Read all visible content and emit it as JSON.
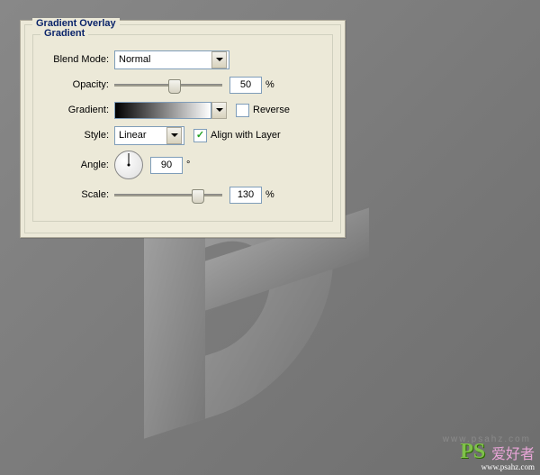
{
  "dialog": {
    "title": "Gradient Overlay",
    "group": "Gradient",
    "blend_mode": {
      "label": "Blend Mode:",
      "value": "Normal"
    },
    "opacity": {
      "label": "Opacity:",
      "value": "50",
      "unit": "%",
      "thumb_pct": 50
    },
    "gradient": {
      "label": "Gradient:"
    },
    "reverse": {
      "label": "Reverse",
      "checked": false
    },
    "style": {
      "label": "Style:",
      "value": "Linear"
    },
    "align": {
      "label": "Align with Layer",
      "checked": true
    },
    "angle": {
      "label": "Angle:",
      "value": "90",
      "unit": "°"
    },
    "scale": {
      "label": "Scale:",
      "value": "130",
      "unit": "%",
      "thumb_pct": 72
    }
  },
  "watermark": {
    "ps": "PS",
    "text": "爱好者",
    "url": "www.psahz.com"
  }
}
